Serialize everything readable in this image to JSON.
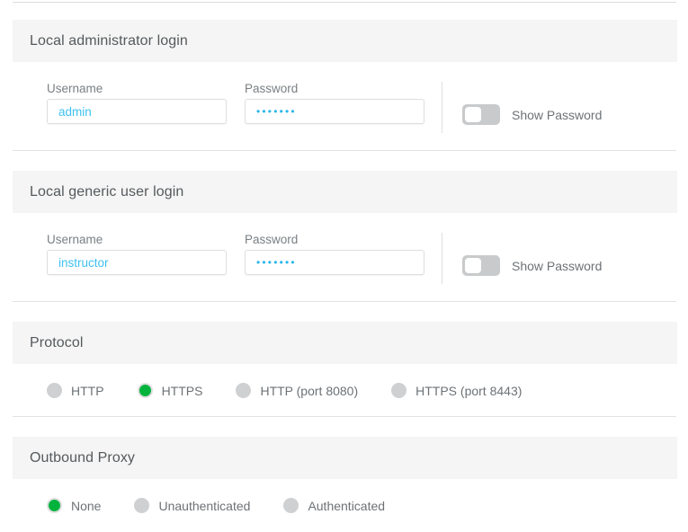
{
  "sections": [
    {
      "id": "local-administrator-login",
      "title": "Local administrator login",
      "type": "login",
      "username": {
        "label": "Username",
        "value": "admin",
        "placeholder": "Username"
      },
      "password": {
        "label": "Password",
        "value": "•••••••",
        "placeholder": "Password"
      },
      "toggle": {
        "label": "Show Password",
        "state": "off"
      }
    },
    {
      "id": "local-generic-user-login",
      "title": "Local generic user login",
      "type": "login",
      "username": {
        "label": "Username",
        "value": "instructor",
        "placeholder": "Username"
      },
      "password": {
        "label": "Password",
        "value": "•••••••",
        "placeholder": "Password"
      },
      "toggle": {
        "label": "Show Password",
        "state": "off"
      }
    },
    {
      "id": "protocol",
      "title": "Protocol",
      "type": "radio",
      "options": [
        {
          "label": "HTTP",
          "selected": false
        },
        {
          "label": "HTTPS",
          "selected": true
        },
        {
          "label": "HTTP (port 8080)",
          "selected": false
        },
        {
          "label": "HTTPS (port 8443)",
          "selected": false
        }
      ]
    },
    {
      "id": "outbound-proxy",
      "title": "Outbound Proxy",
      "type": "radio",
      "options": [
        {
          "label": "None",
          "selected": true
        },
        {
          "label": "Unauthenticated",
          "selected": false
        },
        {
          "label": "Authenticated",
          "selected": false
        }
      ]
    }
  ],
  "colors": {
    "header_background": "#f5f5f5",
    "input_text": "#3ec1f0",
    "radio_selected": "#00b33c",
    "radio_unselected": "#cfd0d2",
    "toggle_track_off": "#c8cacb",
    "rule": "#e2e2e2"
  }
}
